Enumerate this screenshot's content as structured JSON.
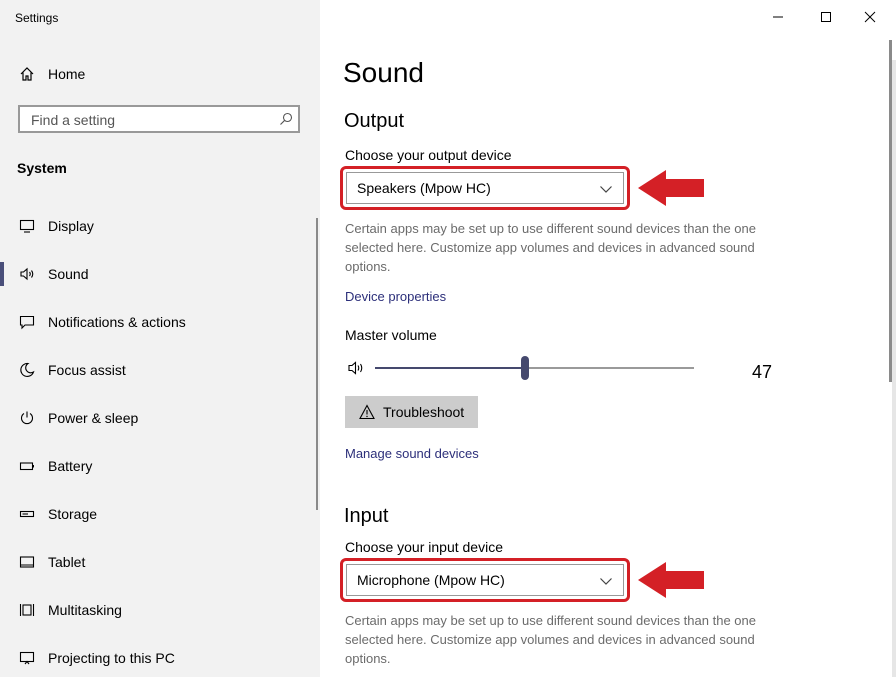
{
  "window": {
    "title": "Settings",
    "controls": {
      "minimize": "—",
      "maximize": "☐",
      "close": "✕"
    }
  },
  "sidebar": {
    "home_label": "Home",
    "search_placeholder": "Find a setting",
    "section_header": "System",
    "items": [
      {
        "label": "Display",
        "icon": "monitor-icon",
        "active": false
      },
      {
        "label": "Sound",
        "icon": "speaker-icon",
        "active": true
      },
      {
        "label": "Notifications & actions",
        "icon": "message-icon",
        "active": false
      },
      {
        "label": "Focus assist",
        "icon": "moon-icon",
        "active": false
      },
      {
        "label": "Power & sleep",
        "icon": "power-icon",
        "active": false
      },
      {
        "label": "Battery",
        "icon": "battery-icon",
        "active": false
      },
      {
        "label": "Storage",
        "icon": "storage-icon",
        "active": false
      },
      {
        "label": "Tablet",
        "icon": "tablet-icon",
        "active": false
      },
      {
        "label": "Multitasking",
        "icon": "multitasking-icon",
        "active": false
      },
      {
        "label": "Projecting to this PC",
        "icon": "projector-icon",
        "active": false
      }
    ]
  },
  "main": {
    "title": "Sound",
    "output": {
      "heading": "Output",
      "choose_label": "Choose your output device",
      "device": "Speakers (Mpow HC)",
      "description": "Certain apps may be set up to use different sound devices than the one selected here. Customize app volumes and devices in advanced sound options.",
      "device_properties_link": "Device properties",
      "master_volume_label": "Master volume",
      "volume": 47,
      "troubleshoot_label": "Troubleshoot",
      "manage_link": "Manage sound devices"
    },
    "input": {
      "heading": "Input",
      "choose_label": "Choose your input device",
      "device": "Microphone (Mpow HC)",
      "description": "Certain apps may be set up to use different sound devices than the one selected here. Customize app volumes and devices in advanced sound options."
    }
  },
  "colors": {
    "accent": "#45496e",
    "highlight_red": "#d42026",
    "link": "#2c2f7a",
    "sidebar_bg": "#f2f2f2"
  }
}
